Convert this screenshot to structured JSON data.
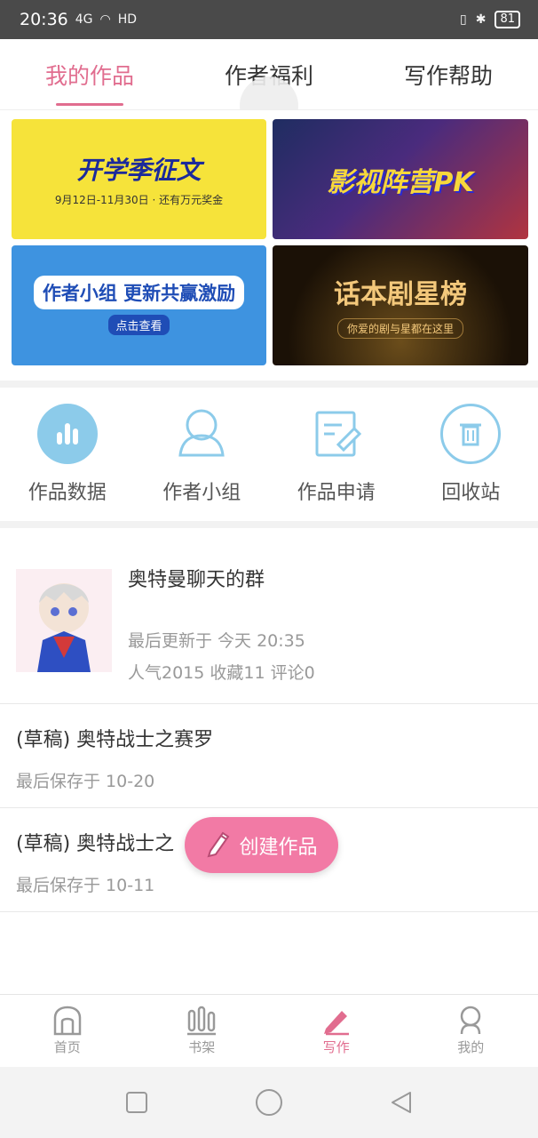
{
  "status_bar": {
    "time": "20:36",
    "network": "4G",
    "wifi_icon": "wifi-icon",
    "hd_label": "HD",
    "battery": "81"
  },
  "tabs": [
    {
      "label": "我的作品",
      "active": true
    },
    {
      "label": "作者福利",
      "active": false
    },
    {
      "label": "写作帮助",
      "active": false
    }
  ],
  "banners": [
    {
      "title": "开学季征文",
      "subtitle": "9月12日-11月30日 · 还有万元奖金"
    },
    {
      "title": "影视阵营PK",
      "subtitle": ""
    },
    {
      "title": "作者小组 更新共赢激励",
      "subtitle": "点击查看"
    },
    {
      "title": "话本剧星榜",
      "subtitle": "你爱的剧与星都在这里"
    }
  ],
  "quick_actions": [
    {
      "label": "作品数据",
      "icon": "bar-chart-icon"
    },
    {
      "label": "作者小组",
      "icon": "group-icon"
    },
    {
      "label": "作品申请",
      "icon": "edit-document-icon"
    },
    {
      "label": "回收站",
      "icon": "trash-icon"
    }
  ],
  "works": {
    "main": {
      "title": "奥特曼聊天的群",
      "updated": "最后更新于 今天 20:35",
      "stats": "人气2015 收藏11 评论0"
    },
    "drafts": [
      {
        "title": "(草稿) 奥特战士之赛罗",
        "saved": "最后保存于 10-20"
      },
      {
        "title": "(草稿) 奥特战士之",
        "saved": "最后保存于 10-11"
      }
    ]
  },
  "fab": {
    "label": "创建作品",
    "icon": "pencil-icon"
  },
  "bottom_nav": [
    {
      "label": "首页",
      "icon": "home-icon",
      "active": false
    },
    {
      "label": "书架",
      "icon": "bookshelf-icon",
      "active": false
    },
    {
      "label": "写作",
      "icon": "pencil-icon",
      "active": true
    },
    {
      "label": "我的",
      "icon": "profile-icon",
      "active": false
    }
  ],
  "colors": {
    "accent": "#e16d8f",
    "fab": "#f27aa5",
    "icon_blue": "#8ccbea"
  }
}
